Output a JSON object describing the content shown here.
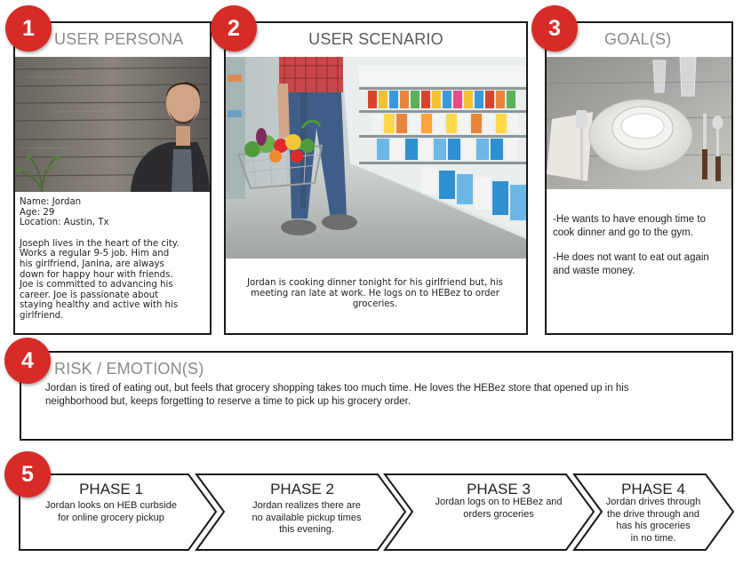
{
  "badges": [
    "1",
    "2",
    "3",
    "4",
    "5"
  ],
  "persona": {
    "title": "USER PERSONA",
    "name": "Name: Jordan",
    "age": "Age: 29",
    "location": "Location: Austin, Tx",
    "bio": "Joseph lives in the heart of the city.\nWorks a regular 9-5 job.  Him and\nhis girlfriend, Janina, are always\ndown for happy hour with friends.\nJoe is committed to advancing his\ncareer. Joe is passionate about\nstaying healthy and active with his\ngirlfriend."
  },
  "scenario": {
    "title": "USER SCENARIO",
    "text": "Jordan is cooking dinner tonight for his girlfriend but, his meeting ran late at work. He logs on to HEBez to order groceries."
  },
  "goals": {
    "title": "GOAL(S)",
    "items": [
      "-He wants to have enough time to cook dinner and go to the gym.",
      "-He does not want to eat out again and waste money."
    ]
  },
  "risk": {
    "title": "RISK / EMOTION(S)",
    "text": "Jordan is tired of eating out, but feels that grocery shopping takes too much time. He loves the HEBez store that opened up in his neighborhood but, keeps forgetting to reserve a time to pick up his grocery order."
  },
  "phases": [
    {
      "title": "PHASE 1",
      "text": "Jordan looks on HEB curbside\nfor online grocery pickup"
    },
    {
      "title": "PHASE 2",
      "text": "Jordan realizes there are\nno available pickup times\nthis evening."
    },
    {
      "title": "PHASE 3",
      "text": "Jordan logs on to HEBez and\norders groceries"
    },
    {
      "title": "PHASE 4",
      "text": "Jordan drives through\nthe drive through and\nhas his groceries\nin no time."
    }
  ],
  "colors": {
    "badge": "#d62b27",
    "title_gray": "#8a8a8a",
    "border": "#1a1a1a"
  }
}
